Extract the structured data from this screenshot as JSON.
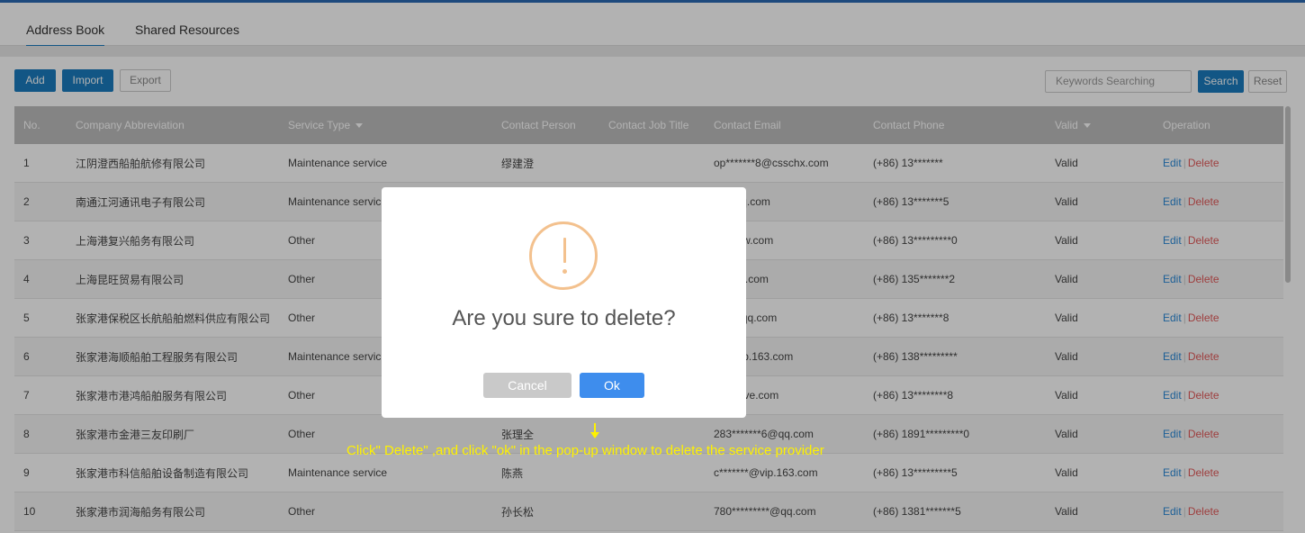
{
  "tabs": [
    "Address Book",
    "Shared Resources"
  ],
  "toolbar": {
    "add_label": "Add",
    "import_label": "Import",
    "export_label": "Export",
    "search_placeholder": "Keywords Searching",
    "search_label": "Search",
    "reset_label": "Reset"
  },
  "table": {
    "headers": {
      "no": "No.",
      "company": "Company Abbreviation",
      "service_type": "Service Type",
      "contact_person": "Contact Person",
      "job_title": "Contact Job Title",
      "email": "Contact Email",
      "phone": "Contact Phone",
      "valid": "Valid",
      "operation": "Operation"
    },
    "edit_label": "Edit",
    "separator": "|",
    "delete_label": "Delete",
    "rows": [
      {
        "no": "1",
        "company": "江阴澄西船舶航修有限公司",
        "service": "Maintenance service",
        "person": "缪建澄",
        "title": "",
        "email": "op*******8@csschx.com",
        "phone": "(+86) 13*******",
        "valid": "Valid"
      },
      {
        "no": "2",
        "company": "南通江河通讯电子有限公司",
        "service": "Maintenance servic",
        "person": "",
        "title": "",
        "email": "*2@qq.com",
        "phone": "(+86) 13*******5",
        "valid": "Valid"
      },
      {
        "no": "3",
        "company": "上海港复兴船务有限公司",
        "service": "Other",
        "person": "",
        "title": "",
        "email": "*@fxcw.com",
        "phone": "(+86) 13*********0",
        "valid": "Valid"
      },
      {
        "no": "4",
        "company": "上海昆旺贸易有限公司",
        "service": "Other",
        "person": "",
        "title": "",
        "email": "**@qq.com",
        "phone": "(+86) 135*******2",
        "valid": "Valid"
      },
      {
        "no": "5",
        "company": "张家港保税区长航船舶燃料供应有限公司",
        "service": "Other",
        "person": "",
        "title": "",
        "email": "****@qq.com",
        "phone": "(+86) 13*******8",
        "valid": "Valid"
      },
      {
        "no": "6",
        "company": "张家港海顺船舶工程服务有限公司",
        "service": "Maintenance servic",
        "person": "",
        "title": "",
        "email": "*g@vip.163.com",
        "phone": "(+86) 138*********",
        "valid": "Valid"
      },
      {
        "no": "7",
        "company": "张家港市港鸿船舶服务有限公司",
        "service": "Other",
        "person": "",
        "title": "",
        "email": "**g@live.com",
        "phone": "(+86) 13********8",
        "valid": "Valid"
      },
      {
        "no": "8",
        "company": "张家港市金港三友印刷厂",
        "service": "Other",
        "person": "张理全",
        "title": "",
        "email": "283*******6@qq.com",
        "phone": "(+86) 1891*********0",
        "valid": "Valid"
      },
      {
        "no": "9",
        "company": "张家港市科信船舶设备制造有限公司",
        "service": "Maintenance service",
        "person": "陈燕",
        "title": "",
        "email": "c*******@vip.163.com",
        "phone": "(+86) 13*********5",
        "valid": "Valid"
      },
      {
        "no": "10",
        "company": "张家港市润海船务有限公司",
        "service": "Other",
        "person": "孙长松",
        "title": "",
        "email": "780*********@qq.com",
        "phone": "(+86) 1381*******5",
        "valid": "Valid"
      }
    ]
  },
  "dialog": {
    "message": "Are you sure to delete?",
    "cancel_label": "Cancel",
    "ok_label": "Ok"
  },
  "annotation": "Click\" Delete\" ,and  click \"ok\" in the pop-up window to delete the service provider",
  "colors": {
    "accent": "#1a7cbf",
    "header_bg": "#bdbdbd",
    "edit": "#2b8ad8",
    "delete": "#e25959",
    "warning": "#f3c18e",
    "ok_button": "#3e8ded",
    "annotation": "#fff200"
  }
}
